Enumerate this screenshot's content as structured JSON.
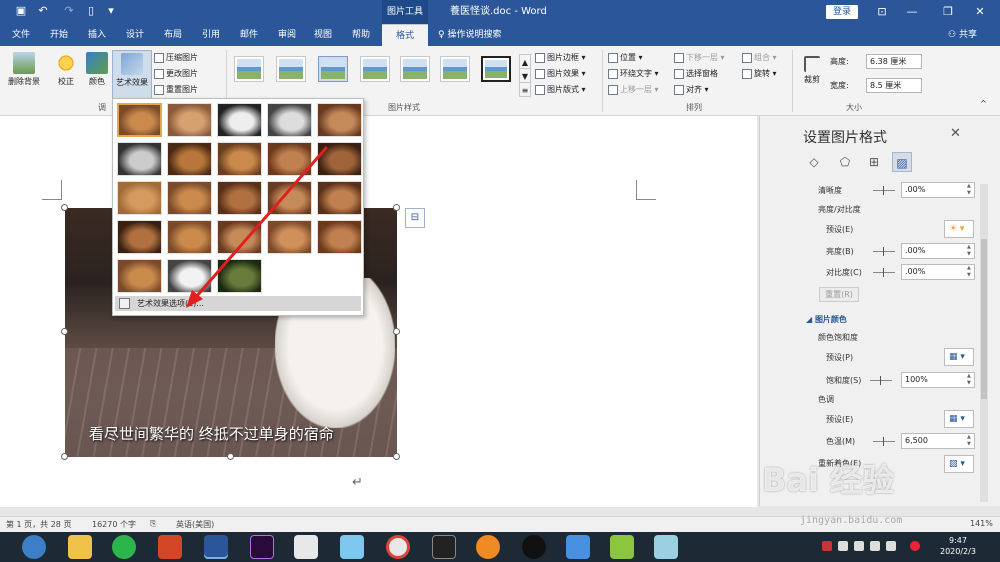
{
  "titlebar": {
    "contextual_tab": "图片工具",
    "doc_title": "養医怪谈.doc  -  Word",
    "login": "登录"
  },
  "tabs": [
    "文件",
    "开始",
    "插入",
    "设计",
    "布局",
    "引用",
    "邮件",
    "审阅",
    "视图",
    "帮助",
    "格式"
  ],
  "search_hint": "操作说明搜索",
  "share": "共享",
  "ribbon": {
    "remove_bg": "删除背景",
    "corrections": "校正",
    "color": "颜色",
    "artistic": "艺术效果",
    "compress": "压缩图片",
    "change_pic": "更改图片",
    "reset_pic": "重置图片",
    "adjust_group": "调",
    "styles_group": "图片样式",
    "border": "图片边框",
    "effects": "图片效果",
    "layout": "图片版式",
    "position": "位置",
    "wrap_text": "环绕文字",
    "bring_forward": "上移一层",
    "send_backward": "下移一层",
    "selection_pane": "选择窗格",
    "align": "对齐",
    "group": "组合",
    "rotate": "旋转",
    "arrange_group": "排列",
    "crop": "裁剪",
    "height_label": "高度:",
    "height_value": "6.38 厘米",
    "width_label": "宽度:",
    "width_value": "8.5 厘米",
    "size_group": "大小"
  },
  "gallery": {
    "options_label": "艺术效果选项(E)..."
  },
  "document": {
    "caption": "看尽世间繁华的 终抵不过单身的宿命"
  },
  "panel": {
    "title": "设置图片格式",
    "sharpness_label": "清晰度",
    "sharpness_value": ".00%",
    "brightness_contrast": "亮度/对比度",
    "preset1": "预设(E)",
    "brightness": "亮度(B)",
    "brightness_value": ".00%",
    "contrast": "对比度(C)",
    "contrast_value": ".00%",
    "reset": "重置(R)",
    "picture_color": "图片颜色",
    "saturation_title": "颜色饱和度",
    "preset2": "预设(P)",
    "saturation": "饱和度(S)",
    "saturation_value": "100%",
    "tone_title": "色调",
    "preset3": "预设(E)",
    "temperature": "色温(M)",
    "temperature_value": "6,500",
    "recolor": "重新着色(E)"
  },
  "status": {
    "page": "第 1 页，共 28 页",
    "words": "16270 个字",
    "lang": "英语(美国)",
    "zoom": "141%"
  },
  "clock": {
    "time": "9:47",
    "date": "2020/2/3"
  },
  "watermark": {
    "main": "Bai 经验",
    "sub": "jingyan.baidu.com"
  }
}
